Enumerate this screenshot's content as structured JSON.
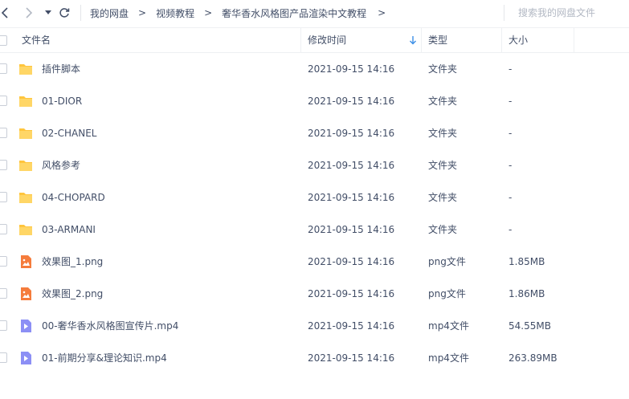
{
  "toolbar": {
    "back": "back-icon",
    "forward": "forward-icon",
    "history": "chevron-down-icon",
    "refresh": "refresh-icon"
  },
  "breadcrumb": {
    "items": [
      "我的网盘",
      "视频教程",
      "奢华香水风格图产品渲染中文教程"
    ],
    "separator": ">"
  },
  "search": {
    "placeholder": "搜索我的网盘文件"
  },
  "columns": {
    "name": "文件名",
    "modified": "修改时间",
    "type": "类型",
    "size": "大小",
    "sort_icon": "sort-desc-icon"
  },
  "colors": {
    "folder": "#ffc53d",
    "image": "#f57c3c",
    "video": "#8c8ff5",
    "text": "#424e67",
    "placeholder": "#b3b9c4",
    "accent": "#3a8ee6"
  },
  "files": [
    {
      "name": "插件脚本",
      "modified": "2021-09-15 14:16",
      "type": "文件夹",
      "size": "-",
      "icon": "folder-icon"
    },
    {
      "name": "01-DIOR",
      "modified": "2021-09-15 14:16",
      "type": "文件夹",
      "size": "-",
      "icon": "folder-icon"
    },
    {
      "name": "02-CHANEL",
      "modified": "2021-09-15 14:16",
      "type": "文件夹",
      "size": "-",
      "icon": "folder-icon"
    },
    {
      "name": "风格参考",
      "modified": "2021-09-15 14:16",
      "type": "文件夹",
      "size": "-",
      "icon": "folder-icon"
    },
    {
      "name": "04-CHOPARD",
      "modified": "2021-09-15 14:16",
      "type": "文件夹",
      "size": "-",
      "icon": "folder-icon"
    },
    {
      "name": "03-ARMANI",
      "modified": "2021-09-15 14:16",
      "type": "文件夹",
      "size": "-",
      "icon": "folder-icon"
    },
    {
      "name": "效果图_1.png",
      "modified": "2021-09-15 14:16",
      "type": "png文件",
      "size": "1.85MB",
      "icon": "image-file-icon"
    },
    {
      "name": "效果图_2.png",
      "modified": "2021-09-15 14:16",
      "type": "png文件",
      "size": "1.86MB",
      "icon": "image-file-icon"
    },
    {
      "name": "00-奢华香水风格图宣传片.mp4",
      "modified": "2021-09-15 14:16",
      "type": "mp4文件",
      "size": "54.55MB",
      "icon": "video-file-icon"
    },
    {
      "name": "01-前期分享&理论知识.mp4",
      "modified": "2021-09-15 14:16",
      "type": "mp4文件",
      "size": "263.89MB",
      "icon": "video-file-icon"
    }
  ]
}
